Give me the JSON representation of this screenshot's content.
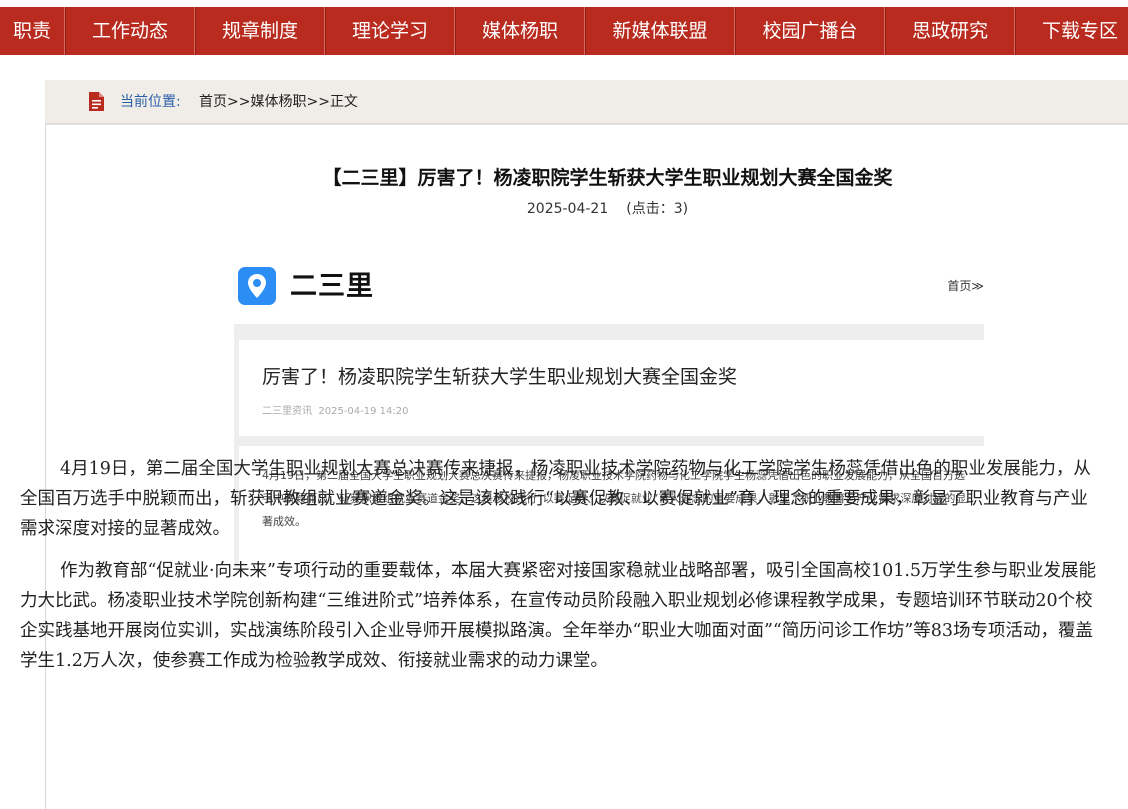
{
  "nav": {
    "items": [
      "职责",
      "工作动态",
      "规章制度",
      "理论学习",
      "媒体杨职",
      "新媒体联盟",
      "校园广播台",
      "思政研究",
      "下载专区"
    ]
  },
  "breadcrumb": {
    "label": "当前位置:",
    "home": "首页",
    "sep": ">>",
    "section": "媒体杨职",
    "current": "正文"
  },
  "article": {
    "title": "【二三里】厉害了！杨凌职院学生斩获大学生职业规划大赛全国金奖",
    "date": "2025-04-21",
    "hits_label": "(点击：",
    "hits": "3",
    "hits_close": ")",
    "paragraphs": [
      "4月19日，第二届全国大学生职业规划大赛总决赛传来捷报，杨凌职业技术学院药物与化工学院学生杨蕊凭借出色的职业发展能力，从全国百万选手中脱颖而出，斩获职教组就业赛道金奖。这是该校践行“以赛促教、以赛促就业”育人理念的重要成果，彰显了职业教育与产业需求深度对接的显著成效。",
      "作为教育部“促就业·向未来”专项行动的重要载体，本届大赛紧密对接国家稳就业战略部署，吸引全国高校101.5万学生参与职业发展能力大比武。杨凌职业技术学院创新构建“三维进阶式”培养体系，在宣传动员阶段融入职业规划必修课程教学成果，专题培训环节联动20个校企实践基地开展岗位实训，实战演练阶段引入企业导师开展模拟路演。全年举办“职业大咖面对面”“简历问诊工作坊”等83场专项活动，覆盖学生1.2万人次，使参赛工作成为检验教学成效、衔接就业需求的动力课堂。"
    ]
  },
  "embed": {
    "app_name": "二三里",
    "home_link": "首页≫",
    "card_title": "厉害了！杨凌职院学生斩获大学生职业规划大赛全国金奖",
    "card_source": "二三里资讯",
    "card_time": "2025-04-19 14:20",
    "card_body": "4月19日，第二届全国大学生职业规划大赛总决赛传来捷报，杨凌职业技术学院药物与化工学院学生杨蕊凭借出色的职业发展能力，从全国百万选手中脱颖而出，斩获职教组就业赛道金奖。这是该校践行“以赛促教、以赛促就业”育人理念的重要成果，彰显了职业教育与产业需求深度对接的显著成效。"
  },
  "colors": {
    "nav_bg": "#b92b1f",
    "crumb_label": "#2a5ea8",
    "crumb_icon": "#b92b1f",
    "logo_blue": "#2c8ef4"
  },
  "icons": {
    "crumb": "document-icon",
    "app": "location-pin-icon"
  }
}
